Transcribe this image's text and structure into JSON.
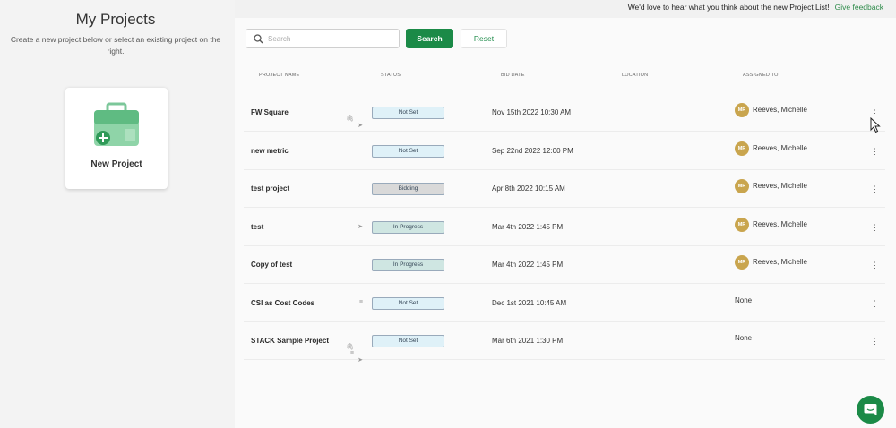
{
  "feedback": {
    "message": "We'd love to hear what you think about the new Project List!",
    "link_label": "Give feedback"
  },
  "sidebar": {
    "title": "My Projects",
    "subtitle": "Create a new project below or select an existing project on the right.",
    "new_project_label": "New Project"
  },
  "toolbar": {
    "search_placeholder": "Search",
    "search_value": "",
    "search_label": "Search",
    "reset_label": "Reset"
  },
  "columns": {
    "name": "PROJECT NAME",
    "status": "STATUS",
    "bid_date": "BID DATE",
    "location": "LOCATION",
    "assigned": "ASSIGNED TO"
  },
  "projects": [
    {
      "name": "FW Square",
      "icons": [
        "paperclip-icon",
        "send-icon"
      ],
      "status": "Not Set",
      "bid_date": "Nov 15th 2022 10:30 AM",
      "initials": "MR",
      "assigned": "Reeves, Michelle"
    },
    {
      "name": "new metric",
      "icons": [],
      "status": "Not Set",
      "bid_date": "Sep 22nd 2022 12:00 PM",
      "initials": "MR",
      "assigned": "Reeves, Michelle"
    },
    {
      "name": "test project",
      "icons": [],
      "status": "Bidding",
      "bid_date": "Apr 8th 2022 10:15 AM",
      "initials": "MR",
      "assigned": "Reeves, Michelle"
    },
    {
      "name": "test",
      "icons": [
        "send-icon"
      ],
      "status": "In Progress",
      "bid_date": "Mar 4th 2022 1:45 PM",
      "initials": "MR",
      "assigned": "Reeves, Michelle"
    },
    {
      "name": "Copy of test",
      "icons": [],
      "status": "In Progress",
      "bid_date": "Mar 4th 2022 1:45 PM",
      "initials": "MR",
      "assigned": "Reeves, Michelle"
    },
    {
      "name": "CSI as Cost Codes",
      "icons": [
        "list-icon"
      ],
      "status": "Not Set",
      "bid_date": "Dec 1st 2021 10:45 AM",
      "initials": "",
      "assigned": "None"
    },
    {
      "name": "STACK Sample Project",
      "icons": [
        "paperclip-icon",
        "list-icon",
        "send-icon"
      ],
      "status": "Not Set",
      "bid_date": "Mar 6th 2021 1:30 PM",
      "initials": "",
      "assigned": "None"
    }
  ],
  "colors": {
    "brand_green": "#1b8a47",
    "avatar_gold": "#c9a54e",
    "not_set": "#dff1f8",
    "bidding": "#d9d9d9",
    "in_progress": "#cfe6e2"
  }
}
